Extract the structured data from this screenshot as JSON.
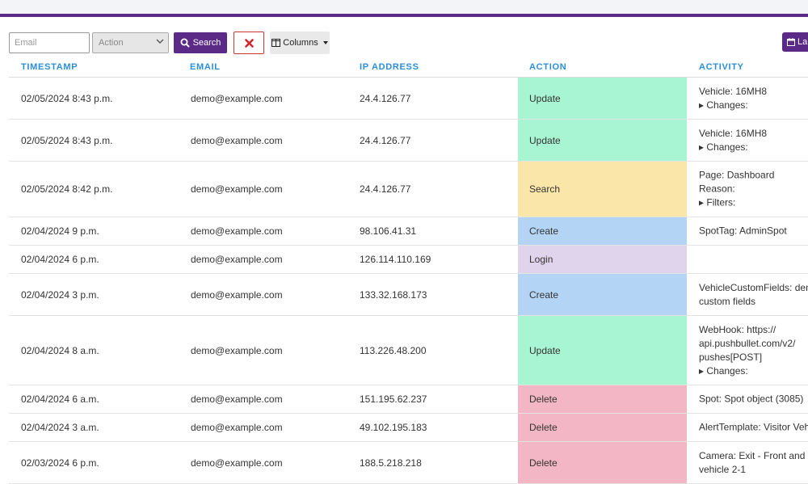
{
  "toolbar": {
    "email_placeholder": "Email",
    "action_select": "Action",
    "search_label": "Search",
    "columns_label": "Columns",
    "last_label": "La"
  },
  "colors": {
    "brand": "#5b2a86",
    "header_text": "#2a8fd8",
    "update": "#a8f5d3",
    "search": "#fbe6a9",
    "create": "#b4d4f5",
    "login": "#e0d4ec",
    "delete": "#f2b6c4"
  },
  "table": {
    "headers": [
      "TIMESTAMP",
      "EMAIL",
      "IP ADDRESS",
      "ACTION",
      "ACTIVITY"
    ],
    "rows": [
      {
        "timestamp": "02/05/2024 8:43 p.m.",
        "email": "demo@example.com",
        "ip": "24.4.126.77",
        "action": "Update",
        "activity": [
          "Vehicle: 16MH8",
          "▸ Changes:"
        ]
      },
      {
        "timestamp": "02/05/2024 8:43 p.m.",
        "email": "demo@example.com",
        "ip": "24.4.126.77",
        "action": "Update",
        "activity": [
          "Vehicle: 16MH8",
          "▸ Changes:"
        ]
      },
      {
        "timestamp": "02/05/2024 8:42 p.m.",
        "email": "demo@example.com",
        "ip": "24.4.126.77",
        "action": "Search",
        "activity": [
          "Page: Dashboard",
          "Reason:",
          "▸ Filters:"
        ]
      },
      {
        "timestamp": "02/04/2024 9 p.m.",
        "email": "demo@example.com",
        "ip": "98.106.41.31",
        "action": "Create",
        "activity": [
          "SpotTag: AdminSpot"
        ]
      },
      {
        "timestamp": "02/04/2024 6 p.m.",
        "email": "demo@example.com",
        "ip": "126.114.110.169",
        "action": "Login",
        "activity": []
      },
      {
        "timestamp": "02/04/2024 3 p.m.",
        "email": "demo@example.com",
        "ip": "133.32.168.173",
        "action": "Create",
        "activity": [
          "VehicleCustomFields: dem",
          "custom fields"
        ]
      },
      {
        "timestamp": "02/04/2024 8 a.m.",
        "email": "demo@example.com",
        "ip": "113.226.48.200",
        "action": "Update",
        "activity": [
          "WebHook: https://",
          "api.pushbullet.com/v2/",
          "pushes[POST]",
          "▸ Changes:"
        ]
      },
      {
        "timestamp": "02/04/2024 6 a.m.",
        "email": "demo@example.com",
        "ip": "151.195.62.237",
        "action": "Delete",
        "activity": [
          "Spot: Spot object (3085)"
        ]
      },
      {
        "timestamp": "02/04/2024 3 a.m.",
        "email": "demo@example.com",
        "ip": "49.102.195.183",
        "action": "Delete",
        "activity": [
          "AlertTemplate: Visitor Vehi"
        ]
      },
      {
        "timestamp": "02/03/2024 6 p.m.",
        "email": "demo@example.com",
        "ip": "188.5.218.218",
        "action": "Delete",
        "activity": [
          "Camera: Exit - Front and re",
          "vehicle 2-1"
        ]
      }
    ]
  }
}
